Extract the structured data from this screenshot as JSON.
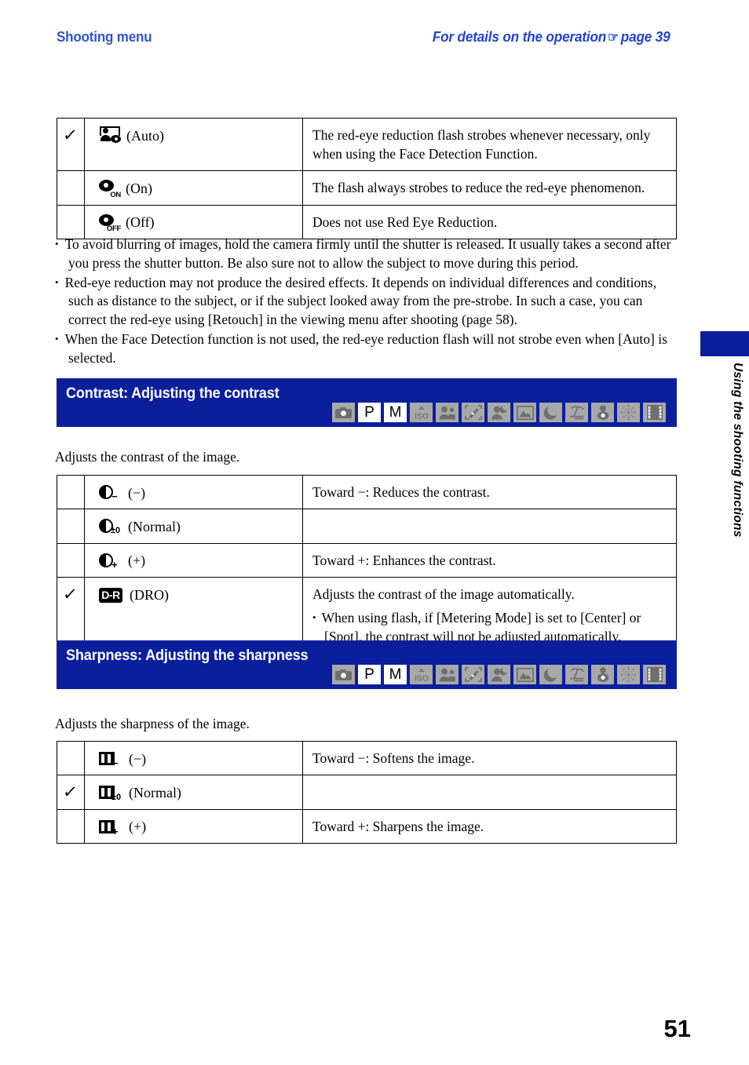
{
  "header": {
    "left_title": "Shooting menu",
    "right_title_before": "For details on the operation",
    "hand_icon": "☞",
    "right_title_after": "page 39"
  },
  "side_tab": {
    "label": "Using the shooting functions"
  },
  "redeye_table": {
    "rows": [
      {
        "checked": true,
        "icon": "face-eye-icon",
        "label": "(Auto)",
        "desc": "The red-eye reduction flash strobes whenever necessary, only when using the Face Detection Function."
      },
      {
        "checked": false,
        "icon": "eye-on-icon",
        "icon_sub": "ON",
        "label": "(On)",
        "desc": "The flash always strobes to reduce the red-eye phenomenon."
      },
      {
        "checked": false,
        "icon": "eye-off-icon",
        "icon_sub": "OFF",
        "label": "(Off)",
        "desc": "Does not use Red Eye Reduction."
      }
    ]
  },
  "notes": [
    "To avoid blurring of images, hold the camera firmly until the shutter is released. It usually takes a second after you press the shutter button. Be also sure not to allow the subject to move during this period.",
    "Red-eye reduction may not produce the desired effects. It depends on individual differences and conditions, such as distance to the subject, or if the subject looked away from the pre-strobe. In such a case, you can correct the red-eye using [Retouch] in the viewing menu after shooting (page 58).",
    "When the Face Detection function is not used, the red-eye reduction flash will not strobe even when [Auto] is selected."
  ],
  "bullet_char": "•",
  "contrast_section": {
    "banner_title": "Contrast: Adjusting the contrast",
    "intro": "Adjusts the contrast of the image.",
    "modes": [
      {
        "name": "still-camera-icon",
        "type": "icon",
        "active": false
      },
      {
        "name": "program-auto-icon",
        "type": "letter",
        "letter": "P",
        "active": true
      },
      {
        "name": "manual-mode-icon",
        "type": "letter",
        "letter": "M",
        "active": true
      },
      {
        "name": "high-sensitivity-iso-icon",
        "type": "icon",
        "active": false
      },
      {
        "name": "soft-snap-icon",
        "type": "icon",
        "active": false
      },
      {
        "name": "anti-blur-icon",
        "type": "icon",
        "active": false
      },
      {
        "name": "twilight-portrait-icon",
        "type": "icon",
        "active": false
      },
      {
        "name": "landscape-icon",
        "type": "icon",
        "active": false
      },
      {
        "name": "twilight-icon",
        "type": "icon",
        "active": false
      },
      {
        "name": "beach-icon",
        "type": "icon",
        "active": false
      },
      {
        "name": "snow-icon",
        "type": "icon",
        "active": false
      },
      {
        "name": "fireworks-icon",
        "type": "icon",
        "active": false
      },
      {
        "name": "movie-mode-icon",
        "type": "icon",
        "active": false
      }
    ],
    "rows": [
      {
        "checked": false,
        "icon": "contrast-minus-icon",
        "icon_suffix": "−",
        "label": "(−)",
        "desc": "Toward −: Reduces the contrast.",
        "bullet": null
      },
      {
        "checked": false,
        "icon": "contrast-normal-icon",
        "icon_suffix": "±0",
        "label": "(Normal)",
        "desc": "",
        "bullet": null
      },
      {
        "checked": false,
        "icon": "contrast-plus-icon",
        "icon_suffix": "+",
        "label": "(+)",
        "desc": "Toward +: Enhances the contrast.",
        "bullet": null
      },
      {
        "checked": true,
        "icon": "dro-icon",
        "icon_text": "D-R",
        "label": "(DRO)",
        "desc": "Adjusts the contrast of the image automatically.",
        "bullet": "When using flash, if [Metering Mode] is set to [Center] or [Spot], the contrast will not be adjusted automatically."
      }
    ]
  },
  "sharpness_section": {
    "banner_title": "Sharpness: Adjusting the sharpness",
    "intro": "Adjusts the sharpness of the image.",
    "modes": [
      {
        "name": "still-camera-icon",
        "type": "icon",
        "active": false
      },
      {
        "name": "program-auto-icon",
        "type": "letter",
        "letter": "P",
        "active": true
      },
      {
        "name": "manual-mode-icon",
        "type": "letter",
        "letter": "M",
        "active": true
      },
      {
        "name": "high-sensitivity-iso-icon",
        "type": "icon",
        "active": false
      },
      {
        "name": "soft-snap-icon",
        "type": "icon",
        "active": false
      },
      {
        "name": "anti-blur-icon",
        "type": "icon",
        "active": false
      },
      {
        "name": "twilight-portrait-icon",
        "type": "icon",
        "active": false
      },
      {
        "name": "landscape-icon",
        "type": "icon",
        "active": false
      },
      {
        "name": "twilight-icon",
        "type": "icon",
        "active": false
      },
      {
        "name": "beach-icon",
        "type": "icon",
        "active": false
      },
      {
        "name": "snow-icon",
        "type": "icon",
        "active": false
      },
      {
        "name": "fireworks-icon",
        "type": "icon",
        "active": false
      },
      {
        "name": "movie-mode-icon",
        "type": "icon",
        "active": false
      }
    ],
    "rows": [
      {
        "checked": false,
        "icon": "sharpness-minus-icon",
        "icon_suffix": "−",
        "label": "(−)",
        "desc": "Toward −: Softens the image."
      },
      {
        "checked": true,
        "icon": "sharpness-normal-icon",
        "icon_suffix": "±0",
        "label": "(Normal)",
        "desc": ""
      },
      {
        "checked": false,
        "icon": "sharpness-plus-icon",
        "icon_suffix": "+",
        "label": "(+)",
        "desc": "Toward +: Sharpens the image."
      }
    ]
  },
  "page_number": "51",
  "colors": {
    "header_blue": "#2244cc",
    "banner_blue": "#0b1f9c",
    "mode_inactive": "#a8a8a8",
    "mode_active": "#ffffff"
  }
}
